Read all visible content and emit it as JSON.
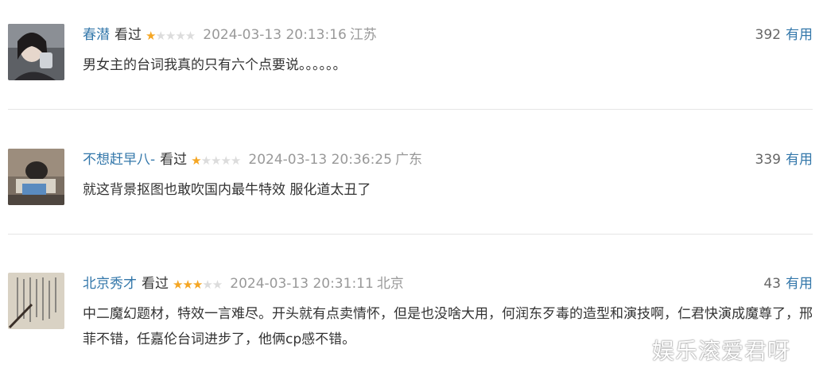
{
  "reviews": [
    {
      "user": "春潜",
      "status": "看过",
      "rating": 1,
      "time": "2024-03-13 20:13:16",
      "location": "江苏",
      "votes": "392",
      "useful_label": "有用",
      "content": "男女主的台词我真的只有六个点要说。。。。。。",
      "avatar": "avatar-photo"
    },
    {
      "user": "不想赶早八-",
      "status": "看过",
      "rating": 1,
      "time": "2024-03-13 20:36:25",
      "location": "广东",
      "votes": "339",
      "useful_label": "有用",
      "content": "就这背景抠图也敢吹国内最牛特效 服化道太丑了",
      "avatar": "avatar-photo"
    },
    {
      "user": "北京秀才",
      "status": "看过",
      "rating": 3,
      "time": "2024-03-13 20:31:11",
      "location": "北京",
      "votes": "43",
      "useful_label": "有用",
      "content": "中二魔幻题材，特效一言难尽。开头就有点卖情怀，但是也没啥大用，何润东歹毒的造型和演技啊，仁君快演成魔尊了，邢菲不错，任嘉伦台词进步了，他俩cp感不错。",
      "avatar": "avatar-photo"
    }
  ],
  "watermark": "娱乐滚爱君呀",
  "colors": {
    "link": "#3377aa",
    "star": "#f5a623",
    "muted": "#999999"
  }
}
